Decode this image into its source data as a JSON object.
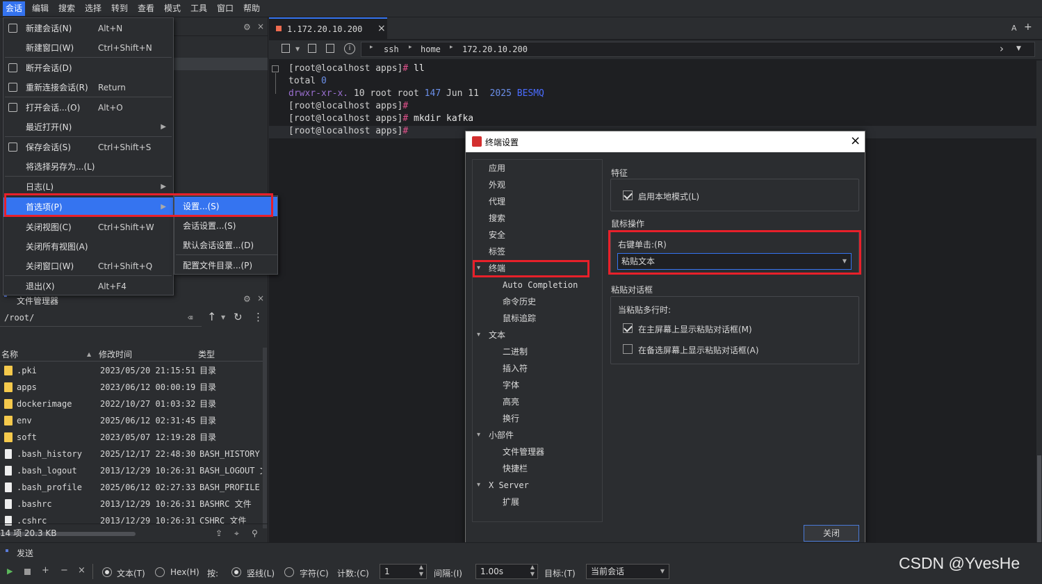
{
  "menubar": [
    "会话",
    "编辑",
    "搜索",
    "选择",
    "转到",
    "查看",
    "模式",
    "工具",
    "窗口",
    "帮助"
  ],
  "session_menu": [
    {
      "label": "新建会话(N)",
      "shortcut": "Alt+N"
    },
    {
      "label": "新建窗口(W)",
      "shortcut": "Ctrl+Shift+N"
    },
    {
      "label": "断开会话(D)",
      "shortcut": ""
    },
    {
      "label": "重新连接会话(R)",
      "shortcut": "Return"
    },
    {
      "label": "打开会话...(O)",
      "shortcut": "Alt+O"
    },
    {
      "label": "最近打开(N)",
      "shortcut": ""
    },
    {
      "label": "保存会话(S)",
      "shortcut": "Ctrl+Shift+S"
    },
    {
      "label": "将选择另存为...(L)",
      "shortcut": ""
    },
    {
      "label": "日志(L)",
      "shortcut": ""
    },
    {
      "label": "首选项(P)",
      "shortcut": ""
    },
    {
      "label": "关闭视图(C)",
      "shortcut": "Ctrl+Shift+W"
    },
    {
      "label": "关闭所有视图(A)",
      "shortcut": ""
    },
    {
      "label": "关闭窗口(W)",
      "shortcut": "Ctrl+Shift+Q"
    },
    {
      "label": "退出(X)",
      "shortcut": "Alt+F4"
    }
  ],
  "prefs_submenu": [
    "设置...(S)",
    "会话设置...(S)",
    "默认会话设置...(D)",
    "配置文件目录...(P)"
  ],
  "terminal": {
    "tab_title": "1.172.20.10.200",
    "crumbs": [
      "ssh",
      "home",
      "172.20.10.200"
    ],
    "lines": [
      {
        "prompt": "[root@localhost apps]",
        "sym": "#",
        "cmd": " ll"
      },
      {
        "plain": "total ",
        "num": "0"
      },
      {
        "perm": "drwxr-xr-x.",
        "rest": " 10 root root ",
        "size": "147",
        "date": " Jun 11  ",
        "year": "2025",
        "dir": " BESMQ"
      },
      {
        "prompt": "[root@localhost apps]",
        "sym": "#",
        "cmd": ""
      },
      {
        "prompt": "[root@localhost apps]",
        "sym": "#",
        "cmd": " mkdir kafka"
      },
      {
        "prompt": "[root@localhost apps]",
        "sym": "#",
        "cmd": ""
      }
    ]
  },
  "file_manager": {
    "title": "文件管理器",
    "path": "/root/",
    "columns": [
      "名称",
      "修改时间",
      "类型"
    ],
    "rows": [
      {
        "name": ".pki",
        "time": "2023/05/20 21:15:51",
        "type": "目录",
        "folder": true
      },
      {
        "name": "apps",
        "time": "2023/06/12 00:00:19",
        "type": "目录",
        "folder": true
      },
      {
        "name": "dockerimage",
        "time": "2022/10/27 01:03:32",
        "type": "目录",
        "folder": true
      },
      {
        "name": "env",
        "time": "2025/06/12 02:31:45",
        "type": "目录",
        "folder": true
      },
      {
        "name": "soft",
        "time": "2023/05/07 12:19:28",
        "type": "目录",
        "folder": true
      },
      {
        "name": ".bash_history",
        "time": "2025/12/17 22:48:30",
        "type": "BASH_HISTORY",
        "folder": false
      },
      {
        "name": ".bash_logout",
        "time": "2013/12/29 10:26:31",
        "type": "BASH_LOGOUT 文",
        "folder": false
      },
      {
        "name": ".bash_profile",
        "time": "2025/06/12 02:27:33",
        "type": "BASH_PROFILE",
        "folder": false
      },
      {
        "name": ".bashrc",
        "time": "2013/12/29 10:26:31",
        "type": "BASHRC 文件",
        "folder": false
      },
      {
        "name": ".cshrc",
        "time": "2013/12/29 10:26:31",
        "type": "CSHRC 文件",
        "folder": false
      }
    ],
    "status": "14 项 20.3 KB"
  },
  "dialog": {
    "title": "终端设置",
    "tree": [
      {
        "label": "应用",
        "level": 1,
        "expand": ""
      },
      {
        "label": "外观",
        "level": 1,
        "expand": ""
      },
      {
        "label": "代理",
        "level": 1,
        "expand": ""
      },
      {
        "label": "搜索",
        "level": 1,
        "expand": ""
      },
      {
        "label": "安全",
        "level": 1,
        "expand": ""
      },
      {
        "label": "标签",
        "level": 1,
        "expand": ""
      },
      {
        "label": "终端",
        "level": 1,
        "expand": "▾"
      },
      {
        "label": "Auto Completion",
        "level": 2,
        "expand": ""
      },
      {
        "label": "命令历史",
        "level": 2,
        "expand": ""
      },
      {
        "label": "鼠标追踪",
        "level": 2,
        "expand": ""
      },
      {
        "label": "文本",
        "level": 1,
        "expand": "▾"
      },
      {
        "label": "二进制",
        "level": 2,
        "expand": ""
      },
      {
        "label": "插入符",
        "level": 2,
        "expand": ""
      },
      {
        "label": "字体",
        "level": 2,
        "expand": ""
      },
      {
        "label": "高亮",
        "level": 2,
        "expand": ""
      },
      {
        "label": "换行",
        "level": 2,
        "expand": ""
      },
      {
        "label": "小部件",
        "level": 1,
        "expand": "▾"
      },
      {
        "label": "文件管理器",
        "level": 2,
        "expand": ""
      },
      {
        "label": "快捷栏",
        "level": 2,
        "expand": ""
      },
      {
        "label": "X Server",
        "level": 1,
        "expand": "▾"
      },
      {
        "label": "扩展",
        "level": 2,
        "expand": ""
      }
    ],
    "features_title": "特征",
    "local_mode": "启用本地模式(L)",
    "mouse_title": "鼠标操作",
    "right_click_label": "右键单击:(R)",
    "right_click_value": "粘贴文本",
    "paste_title": "粘贴对话框",
    "paste_when": "当粘贴多行时:",
    "paste_main": "在主屏幕上显示粘贴对话框(M)",
    "paste_alt": "在备选屏幕上显示粘贴对话框(A)",
    "close_btn": "关闭"
  },
  "send_bar": {
    "title": "发送",
    "text_opt": "文本(T)",
    "hex_opt": "Hex(H)",
    "by": "按:",
    "line_opt": "竖线(L)",
    "char_opt": "字符(C)",
    "count_label": "计数:(C)",
    "count_val": "1",
    "interval_label": "间隔:(I)",
    "interval_val": "1.00s",
    "target_label": "目标:(T)",
    "target_val": "当前会话"
  },
  "watermark": "CSDN @YvesHe",
  "colors": {
    "accent": "#3574f0",
    "highlight": "#e8202a",
    "prompt_sym": "#e0508a",
    "perm": "#9a6fd0",
    "num": "#6b8fe8",
    "dir": "#4a6cff"
  }
}
